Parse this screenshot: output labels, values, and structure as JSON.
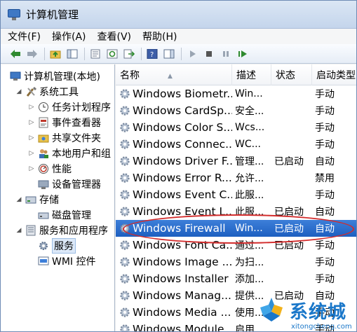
{
  "window": {
    "title": "计算机管理"
  },
  "menu": [
    "文件(F)",
    "操作(A)",
    "查看(V)",
    "帮助(H)"
  ],
  "tree": {
    "root": "计算机管理(本地)",
    "system_tools": "系统工具",
    "task_scheduler": "任务计划程序",
    "event_viewer": "事件查看器",
    "shared_folders": "共享文件夹",
    "local_users": "本地用户和组",
    "performance": "性能",
    "device_manager": "设备管理器",
    "storage": "存储",
    "disk_management": "磁盘管理",
    "services_apps": "服务和应用程序",
    "services": "服务",
    "wmi": "WMI 控件"
  },
  "columns": {
    "name": "名称",
    "desc": "描述",
    "status": "状态",
    "startup": "启动类型"
  },
  "services": [
    {
      "name": "Windows Biometr...",
      "desc": "Win...",
      "status": "",
      "startup": "手动"
    },
    {
      "name": "Windows CardSp...",
      "desc": "安全...",
      "status": "",
      "startup": "手动"
    },
    {
      "name": "Windows Color S...",
      "desc": "Wcs...",
      "status": "",
      "startup": "手动"
    },
    {
      "name": "Windows Connec...",
      "desc": "WC...",
      "status": "",
      "startup": "手动"
    },
    {
      "name": "Windows Driver F...",
      "desc": "管理...",
      "status": "已启动",
      "startup": "自动"
    },
    {
      "name": "Windows Error R...",
      "desc": "允许...",
      "status": "",
      "startup": "禁用"
    },
    {
      "name": "Windows Event C...",
      "desc": "此服...",
      "status": "",
      "startup": "手动"
    },
    {
      "name": "Windows Event L...",
      "desc": "此服...",
      "status": "已启动",
      "startup": "自动"
    },
    {
      "name": "Windows Firewall",
      "desc": "Win...",
      "status": "已启动",
      "startup": "自动"
    },
    {
      "name": "Windows Font Ca...",
      "desc": "通过...",
      "status": "已启动",
      "startup": "手动"
    },
    {
      "name": "Windows Image ...",
      "desc": "为扫...",
      "status": "",
      "startup": "手动"
    },
    {
      "name": "Windows Installer",
      "desc": "添加...",
      "status": "",
      "startup": "手动"
    },
    {
      "name": "Windows Manag...",
      "desc": "提供...",
      "status": "已启动",
      "startup": "自动"
    },
    {
      "name": "Windows Media ...",
      "desc": "使用...",
      "status": "",
      "startup": "手动"
    },
    {
      "name": "Windows Module...",
      "desc": "启用...",
      "status": "",
      "startup": "手动"
    }
  ],
  "highlight_row": 8,
  "watermark": {
    "main": "系统城",
    "sub": "xitongcheng.com"
  },
  "colors": {
    "highlight": "#2a6fcf",
    "annotation": "#d22b2b",
    "watermark": "#1a77c9"
  }
}
